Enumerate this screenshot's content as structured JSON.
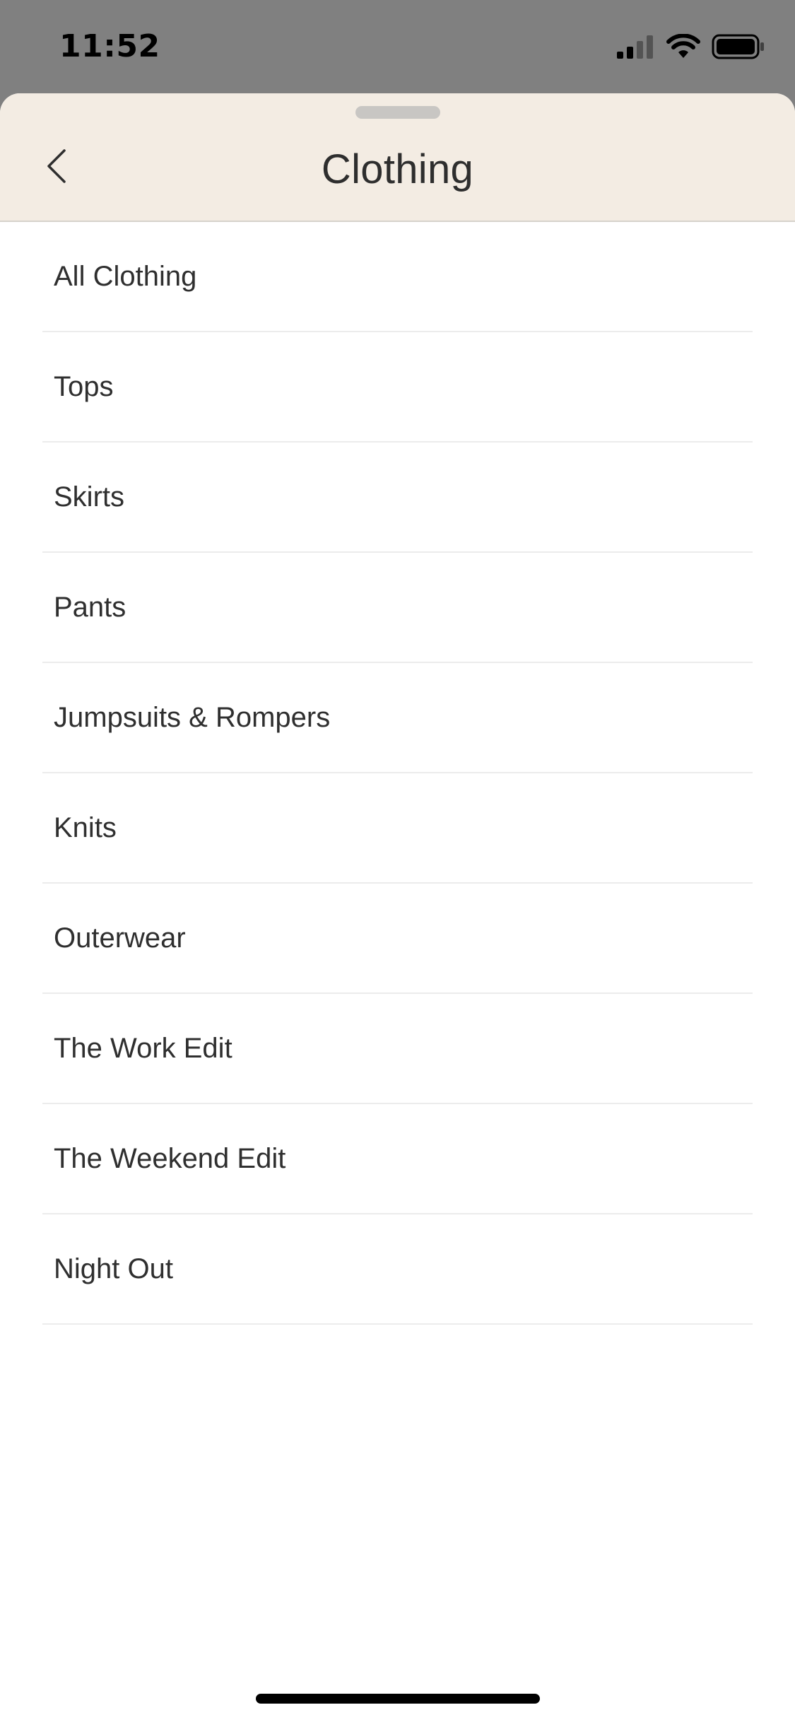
{
  "status_bar": {
    "time": "11:52",
    "icons": [
      "cellular-signal-icon",
      "wifi-icon",
      "battery-icon"
    ]
  },
  "header": {
    "title": "Clothing",
    "back_icon": "chevron-left-icon",
    "background_color": "#f3ece3"
  },
  "menu": {
    "items": [
      {
        "label": "All Clothing"
      },
      {
        "label": "Tops"
      },
      {
        "label": "Skirts"
      },
      {
        "label": "Pants"
      },
      {
        "label": "Jumpsuits & Rompers"
      },
      {
        "label": "Knits"
      },
      {
        "label": "Outerwear"
      },
      {
        "label": "The Work Edit"
      },
      {
        "label": "The Weekend Edit"
      },
      {
        "label": "Night Out"
      }
    ]
  }
}
